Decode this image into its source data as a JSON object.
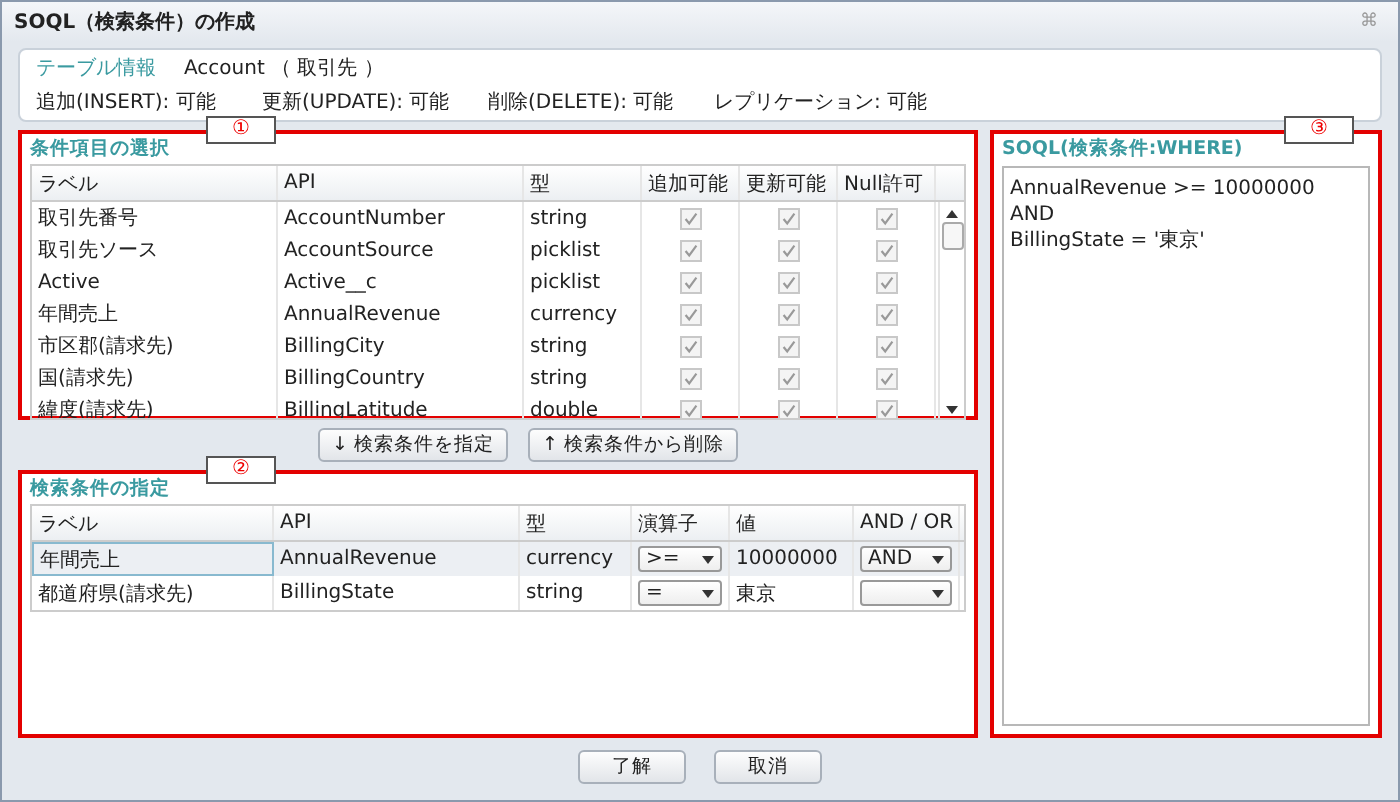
{
  "window": {
    "title": "SOQL（検索条件）の作成",
    "close": "⌘"
  },
  "table_info": {
    "heading": "テーブル情報",
    "object": "Account （ 取引先 ）",
    "permissions": [
      "追加(INSERT): 可能",
      "更新(UPDATE): 可能",
      "削除(DELETE): 可能",
      "レプリケーション: 可能"
    ]
  },
  "field_selection": {
    "title": "条件項目の選択",
    "callout": "①",
    "columns": [
      "ラベル",
      "API",
      "型",
      "追加可能",
      "更新可能",
      "Null許可"
    ],
    "rows": [
      {
        "label": "取引先番号",
        "api": "AccountNumber",
        "type": "string",
        "insertable": true,
        "updatable": true,
        "nullable": true
      },
      {
        "label": "取引先ソース",
        "api": "AccountSource",
        "type": "picklist",
        "insertable": true,
        "updatable": true,
        "nullable": true
      },
      {
        "label": "Active",
        "api": "Active__c",
        "type": "picklist",
        "insertable": true,
        "updatable": true,
        "nullable": true
      },
      {
        "label": "年間売上",
        "api": "AnnualRevenue",
        "type": "currency",
        "insertable": true,
        "updatable": true,
        "nullable": true
      },
      {
        "label": "市区郡(請求先)",
        "api": "BillingCity",
        "type": "string",
        "insertable": true,
        "updatable": true,
        "nullable": true
      },
      {
        "label": "国(請求先)",
        "api": "BillingCountry",
        "type": "string",
        "insertable": true,
        "updatable": true,
        "nullable": true
      },
      {
        "label": "緯度(請求先)",
        "api": "BillingLatitude",
        "type": "double",
        "insertable": true,
        "updatable": true,
        "nullable": true
      }
    ]
  },
  "move_buttons": [
    "↓ 検索条件を指定",
    "↑ 検索条件から削除"
  ],
  "conditions": {
    "title": "検索条件の指定",
    "callout": "②",
    "columns": [
      "ラベル",
      "API",
      "型",
      "演算子",
      "値",
      "AND / OR"
    ],
    "rows": [
      {
        "label": "年間売上",
        "api": "AnnualRevenue",
        "type": "currency",
        "operator": ">=",
        "value": "10000000",
        "conjunction": "AND",
        "selected": true
      },
      {
        "label": "都道府県(請求先)",
        "api": "BillingState",
        "type": "string",
        "operator": "=",
        "value": "東京",
        "selected": false
      }
    ]
  },
  "soql": {
    "title": "SOQL(検索条件:WHERE)",
    "callout": "③",
    "lines": [
      "AnnualRevenue >= 10000000",
      "AND",
      "BillingState = '東京'"
    ]
  },
  "buttons": [
    "了解",
    "取消"
  ]
}
